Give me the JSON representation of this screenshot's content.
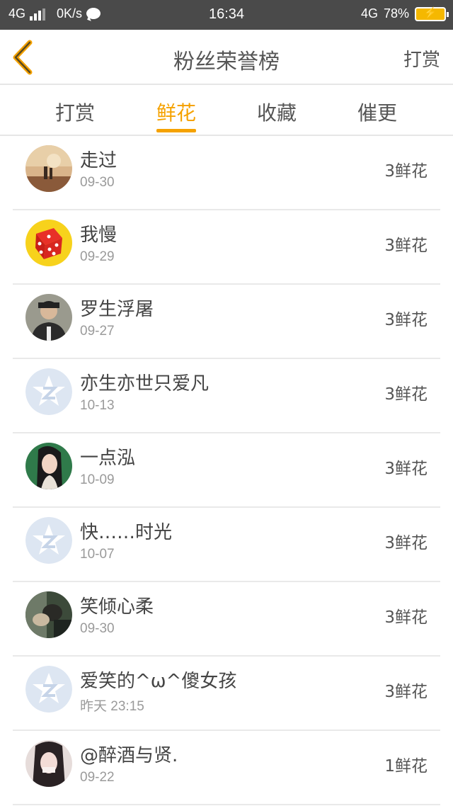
{
  "status_bar": {
    "network_left": "4G",
    "speed": "0K/s",
    "time": "16:34",
    "network_right": "4G",
    "battery": "78%",
    "icons": [
      "signal-icon",
      "chat-icon",
      "battery-icon"
    ]
  },
  "header": {
    "title": "粉丝荣誉榜",
    "right_action": "打赏",
    "back_icon": "chevron-left-icon",
    "accent_color": "#f5a200"
  },
  "tabs": [
    {
      "label": "打赏",
      "active": false
    },
    {
      "label": "鲜花",
      "active": true
    },
    {
      "label": "收藏",
      "active": false
    },
    {
      "label": "催更",
      "active": false
    }
  ],
  "rows": [
    {
      "name": "走过",
      "date": "09-30",
      "count": "3鲜花",
      "avatar": "photo-sunset"
    },
    {
      "name": "我慢",
      "date": "09-29",
      "count": "3鲜花",
      "avatar": "red-dice"
    },
    {
      "name": "罗生浮屠",
      "date": "09-27",
      "count": "3鲜花",
      "avatar": "photo-person"
    },
    {
      "name": "亦生亦世只爱凡",
      "date": "10-13",
      "count": "3鲜花",
      "avatar": "default-star"
    },
    {
      "name": "一点泓",
      "date": "10-09",
      "count": "3鲜花",
      "avatar": "photo-green"
    },
    {
      "name": "快……时光",
      "date": "10-07",
      "count": "3鲜花",
      "avatar": "default-star"
    },
    {
      "name": "笑倾心柔",
      "date": "09-30",
      "count": "3鲜花",
      "avatar": "photo-dark"
    },
    {
      "name": "爱笑的^ω^傻女孩",
      "date": "昨天 23:15",
      "count": "3鲜花",
      "avatar": "default-star"
    },
    {
      "name": "@醉酒与贤.",
      "date": "09-22",
      "count": "1鲜花",
      "avatar": "photo-portrait"
    }
  ]
}
